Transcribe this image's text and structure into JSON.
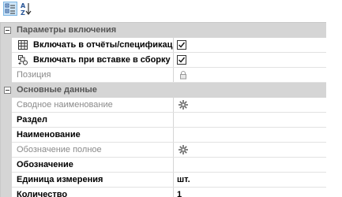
{
  "toolbar": {
    "categorized_icon": "categorized-view-icon",
    "sort_icon": "sort-az-icon"
  },
  "groups": [
    {
      "label": "Параметры включения",
      "items": [
        {
          "name": "Включать в отчёты/спецификац",
          "checked": true
        },
        {
          "name": "Включать при вставке в сборку",
          "checked": true
        },
        {
          "name": "Позиция",
          "value_icon": "lock-icon"
        }
      ]
    },
    {
      "label": "Основные данные",
      "items": [
        {
          "name": "Сводное наименование",
          "value_icon": "gear-icon"
        },
        {
          "name": "Раздел",
          "value": ""
        },
        {
          "name": "Наименование",
          "value": ""
        },
        {
          "name": "Обозначение полное",
          "value_icon": "gear-icon"
        },
        {
          "name": "Обозначение",
          "value": ""
        },
        {
          "name": "Единица измерения",
          "value": "шт."
        },
        {
          "name": "Количество",
          "value": "1"
        }
      ]
    }
  ]
}
